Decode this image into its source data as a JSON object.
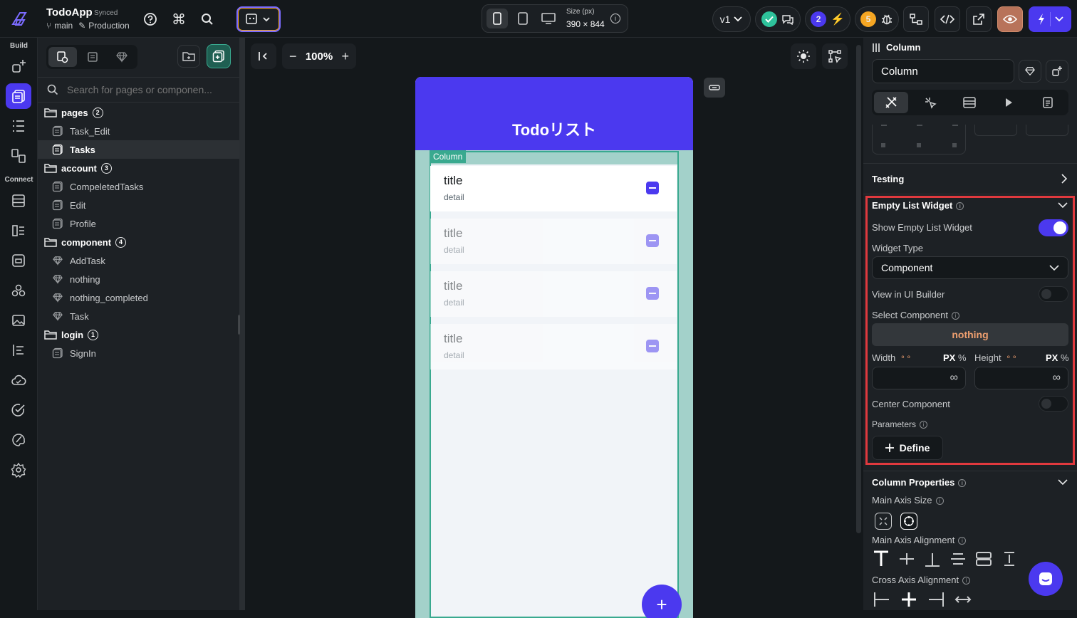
{
  "app": {
    "name": "TodoApp",
    "sync_status": "Synced",
    "branch": "main",
    "environment": "Production"
  },
  "topbar": {
    "size_label": "Size (px)",
    "size_value": "390 × 844",
    "version": "v1",
    "collab_count": "2",
    "issues_count": "5"
  },
  "rail": {
    "build_label": "Build",
    "connect_label": "Connect"
  },
  "nav": {
    "search_placeholder": "Search for pages or componen...",
    "folders": [
      {
        "name": "pages",
        "count": "2",
        "items": [
          "Task_Edit",
          "Tasks"
        ]
      },
      {
        "name": "account",
        "count": "3",
        "items": [
          "CompeletedTasks",
          "Edit",
          "Profile"
        ]
      },
      {
        "name": "component",
        "count": "4",
        "items": [
          "AddTask",
          "nothing",
          "nothing_completed",
          "Task"
        ]
      },
      {
        "name": "login",
        "count": "1",
        "items": [
          "SignIn"
        ]
      }
    ],
    "selected": "Tasks"
  },
  "canvas": {
    "zoom": "100%",
    "app_title": "Todoリスト",
    "column_tag": "Column",
    "tasks": [
      {
        "title": "title",
        "detail": "detail"
      },
      {
        "title": "title",
        "detail": "detail"
      },
      {
        "title": "title",
        "detail": "detail"
      },
      {
        "title": "title",
        "detail": "detail"
      }
    ],
    "fab_symbol": "+"
  },
  "panel": {
    "widget_type_label": "Column",
    "widget_name": "Column",
    "testing_label": "Testing",
    "empty_list": {
      "title": "Empty List Widget",
      "show_label": "Show Empty List Widget",
      "show_on": true,
      "widget_type_label": "Widget Type",
      "widget_type_value": "Component",
      "view_in_builder_label": "View in UI Builder",
      "select_component_label": "Select Component",
      "selected_component": "nothing",
      "width_label": "Width",
      "height_label": "Height",
      "unit_px": "PX",
      "unit_pct": "%",
      "infinity": "∞",
      "center_label": "Center Component",
      "parameters_label": "Parameters",
      "define_label": "Define"
    },
    "column_props": {
      "title": "Column Properties",
      "main_axis_size": "Main Axis Size",
      "main_axis_alignment": "Main Axis Alignment",
      "cross_axis_alignment": "Cross Axis Alignment"
    }
  },
  "colors": {
    "accent": "#4b39ef",
    "highlight_border": "#e0393e",
    "teal": "#39a98f",
    "orange": "#f5a623",
    "green": "#2ec29b"
  }
}
